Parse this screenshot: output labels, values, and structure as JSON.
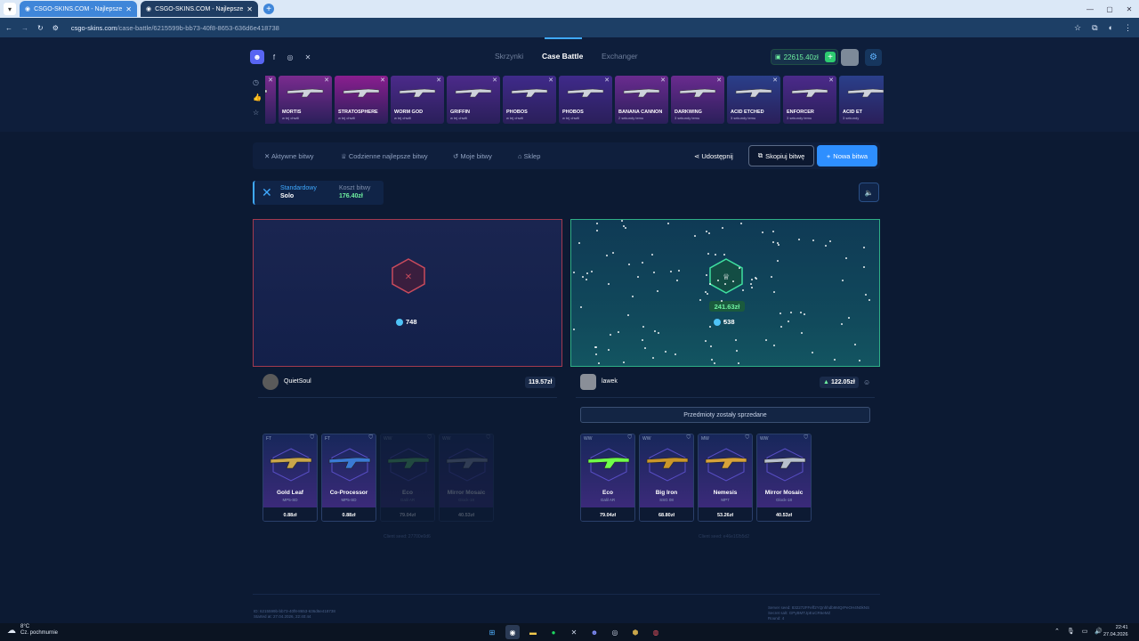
{
  "browser": {
    "tabs": [
      {
        "title": "CSGO-SKINS.COM - Najlepsze"
      },
      {
        "title": "CSGO-SKINS.COM - Najlepsze"
      }
    ],
    "url_domain": "csgo-skins.com",
    "url_path": "/case-battle/6215599b-bb73-40f8-8653-636d6e418738"
  },
  "header": {
    "nav": [
      "Skrzynki",
      "Case Battle",
      "Exchanger"
    ],
    "active_nav": "Case Battle",
    "balance": "22615.40zł"
  },
  "live_drops": [
    {
      "name": "MORTIS",
      "sub": "w tej chwili",
      "color": "#7a2b8f"
    },
    {
      "name": "MORTIS",
      "sub": "w tej chwili",
      "color": "#7a2b8f"
    },
    {
      "name": "STRATOSPHERE",
      "sub": "w tej chwili",
      "color": "#8a1e8f"
    },
    {
      "name": "WORM GOD",
      "sub": "w tej chwili",
      "color": "#4b2a8a"
    },
    {
      "name": "GRIFFIN",
      "sub": "w tej chwili",
      "color": "#4b2a8a"
    },
    {
      "name": "PHOBOS",
      "sub": "w tej chwili",
      "color": "#3f2a8a"
    },
    {
      "name": "PHOBOS",
      "sub": "w tej chwili",
      "color": "#3f2a8a"
    },
    {
      "name": "BANANA CANNON",
      "sub": "2 sekundy temu",
      "color": "#6a2b8f"
    },
    {
      "name": "DARKWING",
      "sub": "3 sekundy temu",
      "color": "#6a2b8f"
    },
    {
      "name": "ACID ETCHED",
      "sub": "3 sekundy temu",
      "color": "#2a3f8a"
    },
    {
      "name": "ENFORCER",
      "sub": "3 sekundy temu",
      "color": "#4b2a8a"
    },
    {
      "name": "ACID ET",
      "sub": "3 sekundy",
      "color": "#2a3f8a"
    }
  ],
  "battle_tabs": {
    "active": "Aktywne bitwy",
    "daily": "Codzienne najlepsze bitwy",
    "mine": "Moje bitwy",
    "shop": "Sklep",
    "share": "Udostępnij",
    "copy": "Skopiuj bitwę",
    "new": "Nowa bitwa"
  },
  "mode": {
    "label": "Standardowy",
    "value": "Solo",
    "cost_label": "Koszt bitwy",
    "cost_value": "176.40zł"
  },
  "players": [
    {
      "name": "QuietSoul",
      "coins": "748",
      "total": "119.57zł",
      "seed": "Client seed: 27700e0d6",
      "items": [
        {
          "cond": "FT",
          "name": "Gold Leaf",
          "sub": "MP5-SD",
          "price": "0.88zł",
          "faded": false,
          "accent": "#c9a64a"
        },
        {
          "cond": "FT",
          "name": "Co-Processor",
          "sub": "MP5-SD",
          "price": "0.88zł",
          "faded": false,
          "accent": "#3a7bd5"
        },
        {
          "cond": "WW",
          "name": "Eco",
          "sub": "Galil AR",
          "price": "79.04zł",
          "faded": true,
          "accent": "#5fd46a"
        },
        {
          "cond": "WW",
          "name": "Mirror Mosaic",
          "sub": "Glock-18",
          "price": "40.53zł",
          "faded": true,
          "accent": "#9aa3b5"
        }
      ]
    },
    {
      "name": "lawek",
      "coins": "538",
      "win_amount": "241.63zł",
      "total": "122.05zł",
      "sold_text": "Przedmioty zostały sprzedane",
      "seed": "Client seed: e46e1f2b5d2",
      "items": [
        {
          "cond": "WW",
          "name": "Eco",
          "sub": "Galil AR",
          "price": "79.04zł",
          "faded": false,
          "accent": "#6fff4a"
        },
        {
          "cond": "WW",
          "name": "Big Iron",
          "sub": "SSG 08",
          "price": "68.80zł",
          "faded": false,
          "accent": "#c9962a"
        },
        {
          "cond": "MW",
          "name": "Nemesis",
          "sub": "MP7",
          "price": "53.26zł",
          "faded": false,
          "accent": "#d6a23a"
        },
        {
          "cond": "WW",
          "name": "Mirror Mosaic",
          "sub": "Glock-18",
          "price": "40.53zł",
          "faded": false,
          "accent": "#b8c0cc"
        }
      ]
    }
  ],
  "footer": {
    "id_line": "ID: 6215599b-bb73-40f8-8653-636d6e418738",
    "started": "Started at: 27.04.2026, 22:40:44",
    "server_seed": "Server seed: 832272FFeff2YQnhhdb9MQrPeOH4N0kNS",
    "secret_salt": "Secret salt: GPyBMTJpEuCR6eMZ",
    "round": "Round: 4"
  },
  "taskbar": {
    "weather_temp": "8°C",
    "weather_desc": "Cz. pochmurnie",
    "time": "22:41",
    "date": "27.04.2026"
  }
}
